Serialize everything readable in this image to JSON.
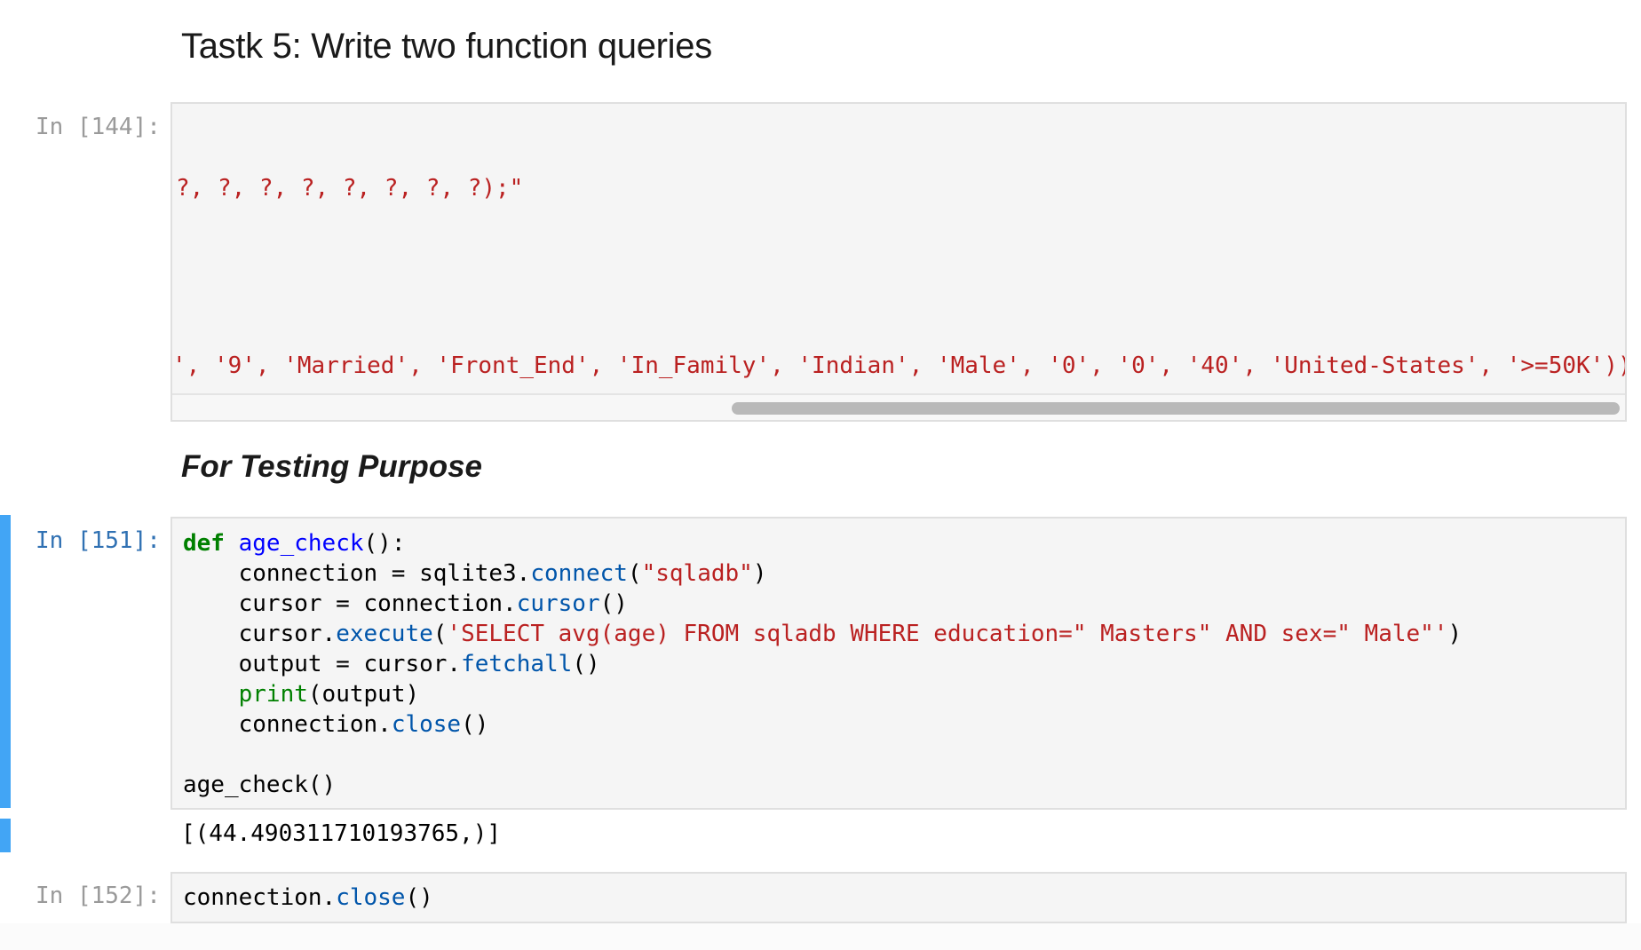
{
  "headings": {
    "task": "Tastk 5: Write two function queries",
    "testing": "For Testing Purpose"
  },
  "cells": [
    {
      "prompt": "In [144]:",
      "lines": {
        "placeholders": "?, ?, ?, ?, ?, ?, ?, ?);\"",
        "values_prefix": "', ",
        "values": "'9', 'Married', 'Front_End', 'In_Family', 'Indian', 'Male', '0', '0', '40', 'United-States', '>=50K'))"
      }
    },
    {
      "prompt": "In [151]:",
      "code": {
        "l1_kw": "def",
        "l1_fn": "age_check",
        "l1_rest": "():",
        "l2_a": "    connection = sqlite3.",
        "l2_attr": "connect",
        "l2_b": "(",
        "l2_str": "\"sqladb\"",
        "l2_c": ")",
        "l3_a": "    cursor = connection.",
        "l3_attr": "cursor",
        "l3_b": "()",
        "l4_a": "    cursor.",
        "l4_attr": "execute",
        "l4_b": "(",
        "l4_str": "'SELECT avg(age) FROM sqladb WHERE education=\" Masters\" AND sex=\" Male\"'",
        "l4_c": ")",
        "l5_a": "    output = cursor.",
        "l5_attr": "fetchall",
        "l5_b": "()",
        "l6_indent": "    ",
        "l6_bi": "print",
        "l6_b": "(output)",
        "l7_a": "    connection.",
        "l7_attr": "close",
        "l7_b": "()",
        "l9": "age_check()"
      },
      "output": "[(44.490311710193765,)]"
    },
    {
      "prompt": "In [152]:",
      "code": {
        "a": "connection.",
        "attr": "close",
        "b": "()"
      }
    }
  ],
  "colors": {
    "string": "#ba2121",
    "keyword": "#008000",
    "function_def": "#0000ff",
    "attribute": "#0055aa",
    "selection_bar": "#42a5f5",
    "prompt_inactive": "#9a9a9a",
    "prompt_active": "#3071b3"
  }
}
